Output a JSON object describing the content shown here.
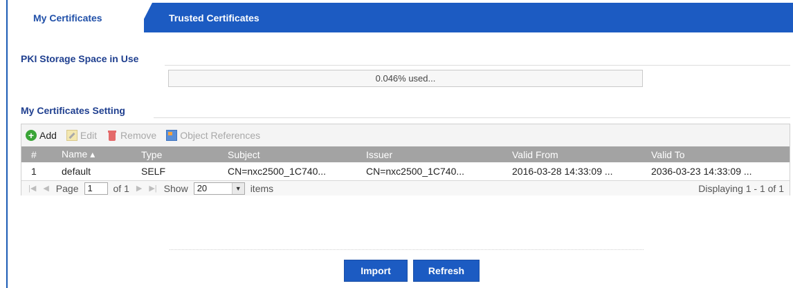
{
  "tabs": [
    {
      "label": "My Certificates",
      "active": true
    },
    {
      "label": "Trusted Certificates",
      "active": false
    }
  ],
  "storage": {
    "title": "PKI Storage Space in Use",
    "usage_text": "0.046% used...",
    "used_percent": 0.046
  },
  "settings": {
    "title": "My Certificates Setting",
    "toolbar": {
      "add": "Add",
      "edit": "Edit",
      "remove": "Remove",
      "references": "Object References"
    },
    "columns": [
      "#",
      "Name ▴",
      "Type",
      "Subject",
      "Issuer",
      "Valid From",
      "Valid To"
    ],
    "rows": [
      {
        "num": "1",
        "name": "default",
        "type": "SELF",
        "subject": "CN=nxc2500_1C740...",
        "issuer": "CN=nxc2500_1C740...",
        "valid_from": "2016-03-28 14:33:09 ...",
        "valid_to": "2036-03-23 14:33:09 ..."
      }
    ],
    "pager": {
      "page_label": "Page",
      "page_value": "1",
      "of_label": "of 1",
      "show_label": "Show",
      "show_value": "20",
      "items_label": "items",
      "display_text": "Displaying 1 - 1 of 1"
    }
  },
  "buttons": {
    "import": "Import",
    "refresh": "Refresh"
  },
  "colors": {
    "accent": "#1c5bc2",
    "header_gray": "#a3a3a3",
    "title_blue": "#1f3f8f"
  }
}
